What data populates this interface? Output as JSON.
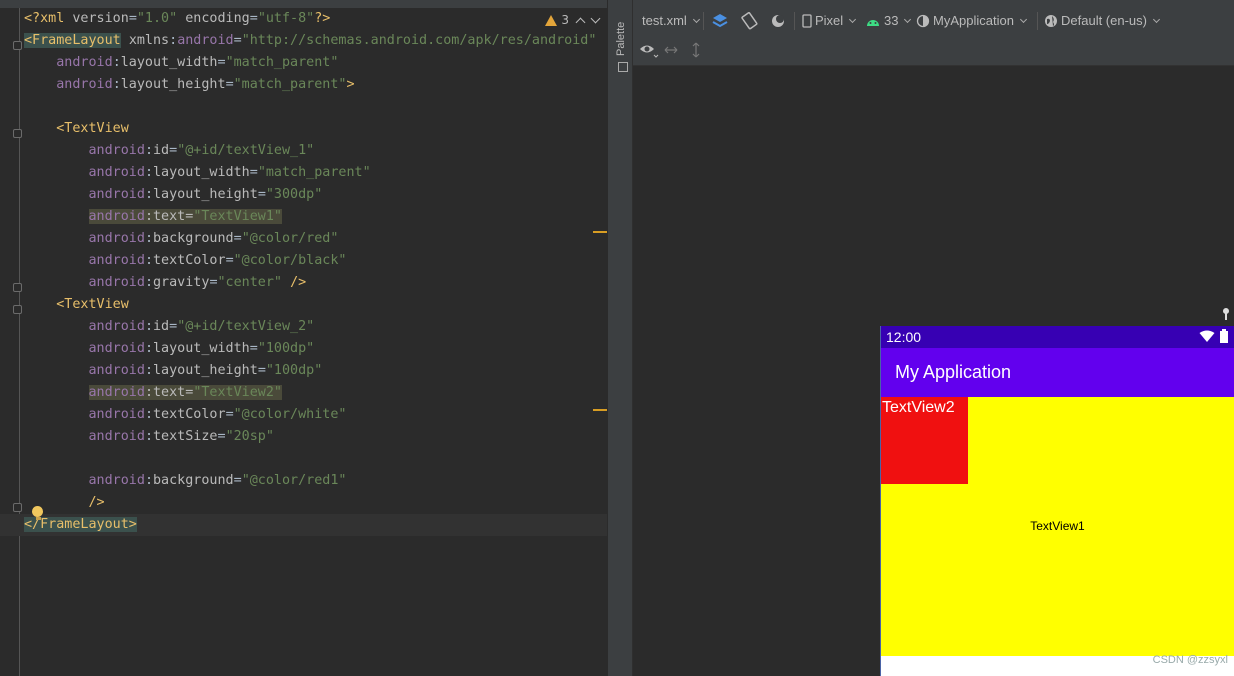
{
  "editor": {
    "warning_count": "3",
    "lines": [
      [
        [
          "tag",
          "<?xml "
        ],
        [
          "attr",
          "version"
        ],
        [
          "",
          "="
        ],
        [
          "val",
          "\"1.0\""
        ],
        [
          "",
          " "
        ],
        [
          "attr",
          "encoding"
        ],
        [
          "",
          "="
        ],
        [
          "val",
          "\"utf-8\""
        ],
        [
          "tag",
          "?>"
        ]
      ],
      [
        [
          "tag-hl",
          "<FrameLayout"
        ],
        [
          "",
          " "
        ],
        [
          "attr",
          "xmlns"
        ],
        [
          "",
          ":"
        ],
        [
          "ns",
          "android"
        ],
        [
          "",
          "="
        ],
        [
          "val",
          "\"http://schemas.android.com/apk/res/android\""
        ]
      ],
      [
        [
          "",
          "    "
        ],
        [
          "ns",
          "android"
        ],
        [
          "",
          ":"
        ],
        [
          "attr",
          "layout_width"
        ],
        [
          "",
          "="
        ],
        [
          "val",
          "\"match_parent\""
        ]
      ],
      [
        [
          "",
          "    "
        ],
        [
          "ns",
          "android"
        ],
        [
          "",
          ":"
        ],
        [
          "attr",
          "layout_height"
        ],
        [
          "",
          "="
        ],
        [
          "val",
          "\"match_parent\""
        ],
        [
          "tag",
          ">"
        ]
      ],
      [],
      [
        [
          "",
          "    "
        ],
        [
          "tag",
          "<TextView"
        ]
      ],
      [
        [
          "",
          "        "
        ],
        [
          "ns",
          "android"
        ],
        [
          "",
          ":"
        ],
        [
          "attr",
          "id"
        ],
        [
          "",
          "="
        ],
        [
          "val",
          "\"@+id/textView_1\""
        ]
      ],
      [
        [
          "",
          "        "
        ],
        [
          "ns",
          "android"
        ],
        [
          "",
          ":"
        ],
        [
          "attr",
          "layout_width"
        ],
        [
          "",
          "="
        ],
        [
          "val",
          "\"match_parent\""
        ]
      ],
      [
        [
          "",
          "        "
        ],
        [
          "ns",
          "android"
        ],
        [
          "",
          ":"
        ],
        [
          "attr",
          "layout_height"
        ],
        [
          "",
          "="
        ],
        [
          "val",
          "\"300dp\""
        ]
      ],
      [
        [
          "",
          "        "
        ],
        [
          "ns-hl",
          "android"
        ],
        [
          "attr-hl",
          ":"
        ],
        [
          "attr-hl",
          "text"
        ],
        [
          "attr-hl",
          "="
        ],
        [
          "val-hl",
          "\"TextView1\""
        ]
      ],
      [
        [
          "",
          "        "
        ],
        [
          "ns",
          "android"
        ],
        [
          "",
          ":"
        ],
        [
          "attr",
          "background"
        ],
        [
          "",
          "="
        ],
        [
          "val",
          "\"@color/red\""
        ]
      ],
      [
        [
          "",
          "        "
        ],
        [
          "ns",
          "android"
        ],
        [
          "",
          ":"
        ],
        [
          "attr",
          "textColor"
        ],
        [
          "",
          "="
        ],
        [
          "val",
          "\"@color/black\""
        ]
      ],
      [
        [
          "",
          "        "
        ],
        [
          "ns",
          "android"
        ],
        [
          "",
          ":"
        ],
        [
          "attr",
          "gravity"
        ],
        [
          "",
          "="
        ],
        [
          "val",
          "\"center\""
        ],
        [
          "",
          " "
        ],
        [
          "tag",
          "/>"
        ]
      ],
      [
        [
          "",
          "    "
        ],
        [
          "tag",
          "<TextView"
        ]
      ],
      [
        [
          "",
          "        "
        ],
        [
          "ns",
          "android"
        ],
        [
          "",
          ":"
        ],
        [
          "attr",
          "id"
        ],
        [
          "",
          "="
        ],
        [
          "val",
          "\"@+id/textView_2\""
        ]
      ],
      [
        [
          "",
          "        "
        ],
        [
          "ns",
          "android"
        ],
        [
          "",
          ":"
        ],
        [
          "attr",
          "layout_width"
        ],
        [
          "",
          "="
        ],
        [
          "val",
          "\"100dp\""
        ]
      ],
      [
        [
          "",
          "        "
        ],
        [
          "ns",
          "android"
        ],
        [
          "",
          ":"
        ],
        [
          "attr",
          "layout_height"
        ],
        [
          "",
          "="
        ],
        [
          "val",
          "\"100dp\""
        ]
      ],
      [
        [
          "",
          "        "
        ],
        [
          "ns-hl",
          "android"
        ],
        [
          "attr-hl",
          ":"
        ],
        [
          "attr-hl",
          "text"
        ],
        [
          "attr-hl",
          "="
        ],
        [
          "val-hl",
          "\"TextView2\""
        ]
      ],
      [
        [
          "",
          "        "
        ],
        [
          "ns",
          "android"
        ],
        [
          "",
          ":"
        ],
        [
          "attr",
          "textColor"
        ],
        [
          "",
          "="
        ],
        [
          "val",
          "\"@color/white\""
        ]
      ],
      [
        [
          "",
          "        "
        ],
        [
          "ns",
          "android"
        ],
        [
          "",
          ":"
        ],
        [
          "attr",
          "textSize"
        ],
        [
          "",
          "="
        ],
        [
          "val",
          "\"20sp\""
        ]
      ],
      [],
      [
        [
          "",
          "        "
        ],
        [
          "ns",
          "android"
        ],
        [
          "",
          ":"
        ],
        [
          "attr",
          "background"
        ],
        [
          "",
          "="
        ],
        [
          "val",
          "\"@color/red1\""
        ]
      ],
      [
        [
          "",
          "        "
        ],
        [
          "tag",
          "/>"
        ]
      ],
      [
        [
          "tag-hl",
          "</FrameLayout>"
        ]
      ]
    ]
  },
  "palette": {
    "label": "Palette"
  },
  "toolbar": {
    "file": "test.xml",
    "device": "Pixel",
    "api": "33",
    "theme": "MyApplication",
    "locale": "Default (en-us)"
  },
  "preview": {
    "status_time": "12:00",
    "app_title": "My Application",
    "textview1": "TextView1",
    "textview2": "TextView2"
  },
  "watermark": "CSDN @zzsyxl",
  "colors": {
    "status_bar": "#3700b3",
    "app_bar": "#6200ee",
    "textview1_bg": "#ffff00",
    "textview2_bg": "#f01010"
  }
}
